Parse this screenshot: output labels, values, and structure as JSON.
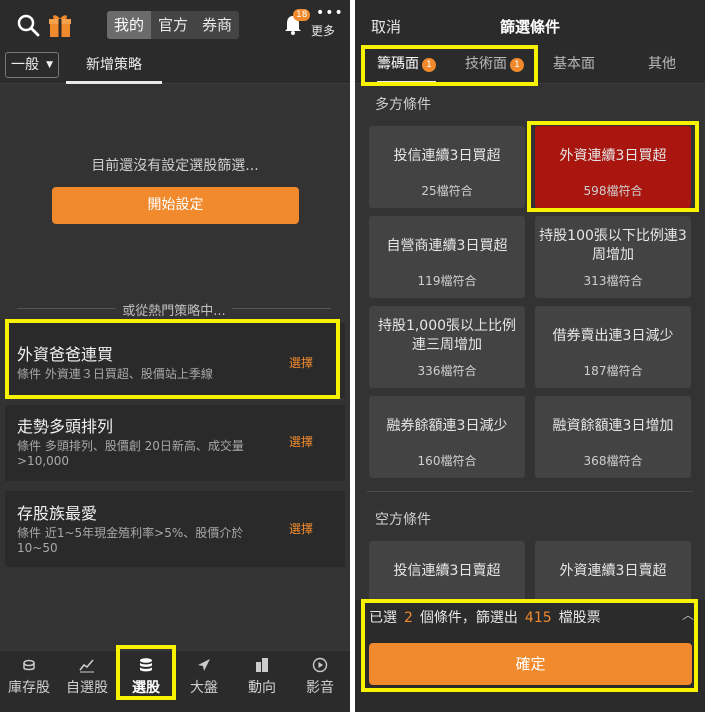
{
  "left": {
    "header": {
      "segments": [
        "我的",
        "官方",
        "券商"
      ],
      "active_segment": 0,
      "notification_count": "18",
      "more_label": "更多"
    },
    "tabs": {
      "dropdown": "一般",
      "new_strategy": "新增策略"
    },
    "empty_message": "目前還沒有設定選股篩選...",
    "start_button": "開始設定",
    "popular_divider": "或從熱門策略中...",
    "strategies": [
      {
        "title": "外資爸爸連買",
        "desc": "條件 外資連３日買超、股價站上季線",
        "action": "選擇"
      },
      {
        "title": "走勢多頭排列",
        "desc": "條件 多頭排列、股價創 20日新高、成交量>10,000",
        "action": "選擇"
      },
      {
        "title": "存股族最愛",
        "desc": "條件 近1~5年現金殖利率>5%、股價介於10~50",
        "action": "選擇"
      }
    ],
    "bottom_nav": [
      "庫存股",
      "自選股",
      "選股",
      "大盤",
      "動向",
      "影音"
    ],
    "active_nav": 2
  },
  "right": {
    "cancel": "取消",
    "title": "篩選條件",
    "tabs": [
      {
        "label": "籌碼面",
        "badge": "1"
      },
      {
        "label": "技術面",
        "badge": "1"
      },
      {
        "label": "基本面",
        "badge": ""
      },
      {
        "label": "其他",
        "badge": ""
      }
    ],
    "long_section": "多方條件",
    "long_options": [
      {
        "name": "投信連續3日買超",
        "count": "25檔符合",
        "selected": false
      },
      {
        "name": "外資連續3日買超",
        "count": "598檔符合",
        "selected": true
      },
      {
        "name": "自營商連續3日買超",
        "count": "119檔符合",
        "selected": false
      },
      {
        "name": "持股100張以下比例連3周增加",
        "count": "313檔符合",
        "selected": false
      },
      {
        "name": "持股1,000張以上比例連三周增加",
        "count": "336檔符合",
        "selected": false
      },
      {
        "name": "借券賣出連3日減少",
        "count": "187檔符合",
        "selected": false
      },
      {
        "name": "融券餘額連3日減少",
        "count": "160檔符合",
        "selected": false
      },
      {
        "name": "融資餘額連3日增加",
        "count": "368檔符合",
        "selected": false
      }
    ],
    "short_section": "空方條件",
    "short_options": [
      {
        "name": "投信連續3日賣超"
      },
      {
        "name": "外資連續3日賣超"
      }
    ],
    "summary": {
      "prefix": "已選",
      "selected_count": "2",
      "middle": "個條件，篩選出",
      "result_count": "415",
      "suffix": "檔股票"
    },
    "confirm_button": "確定"
  },
  "colors": {
    "accent": "#f08a2c",
    "selected_option": "#a8160f",
    "highlight": "#f7f200"
  }
}
